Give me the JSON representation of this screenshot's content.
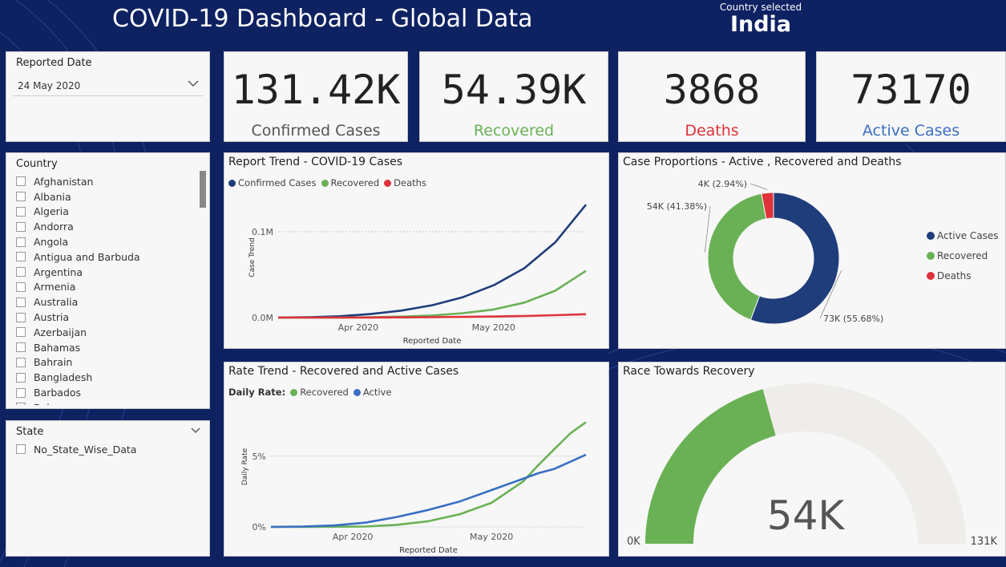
{
  "header": {
    "title": "COVID-19 Dashboard - Global Data",
    "country_label": "Country selected",
    "country_value": "India"
  },
  "reported_date": {
    "title": "Reported Date",
    "value": "24 May 2020"
  },
  "kpis": [
    {
      "value": "131.42K",
      "label": "Confirmed Cases",
      "color": "#555555"
    },
    {
      "value": "54.39K",
      "label": "Recovered",
      "color": "#6ab155"
    },
    {
      "value": "3868",
      "label": "Deaths",
      "color": "#e0323b"
    },
    {
      "value": "73170",
      "label": "Active Cases",
      "color": "#3a6fc4"
    }
  ],
  "country_slicer": {
    "title": "Country",
    "items": [
      "Afghanistan",
      "Albania",
      "Algeria",
      "Andorra",
      "Angola",
      "Antigua and Barbuda",
      "Argentina",
      "Armenia",
      "Australia",
      "Austria",
      "Azerbaijan",
      "Bahamas",
      "Bahrain",
      "Bangladesh",
      "Barbados",
      "Belarus"
    ]
  },
  "state_slicer": {
    "title": "State",
    "items": [
      "No_State_Wise_Data"
    ]
  },
  "report_trend": {
    "title": "Report Trend - COVID-19 Cases"
  },
  "case_proportions": {
    "title": "Case Proportions - Active , Recovered and Deaths"
  },
  "rate_trend": {
    "title": "Rate Trend - Recovered and Active Cases",
    "legend_prefix": "Daily Rate:"
  },
  "race": {
    "title": "Race Towards Recovery"
  },
  "icons": {
    "dropdown": "chevron-down-icon"
  },
  "chart_data": [
    {
      "type": "line",
      "title": "Report Trend - COVID-19 Cases",
      "xlabel": "Reported Date",
      "ylabel": "Case Trend",
      "x_ticks": [
        "Apr 2020",
        "May 2020"
      ],
      "y_ticks": [
        "0.0M",
        "0.1M"
      ],
      "ylim": [
        0,
        0.14
      ],
      "x": [
        0,
        0.1,
        0.2,
        0.3,
        0.4,
        0.5,
        0.6,
        0.7,
        0.8,
        0.9,
        1.0
      ],
      "series": [
        {
          "name": "Confirmed Cases",
          "color": "#1f3d7a",
          "values": [
            0.0001,
            0.0005,
            0.0016,
            0.0041,
            0.0081,
            0.0144,
            0.0237,
            0.0376,
            0.0575,
            0.0875,
            0.1314
          ]
        },
        {
          "name": "Recovered",
          "color": "#6ab155",
          "values": [
            0,
            0,
            0.0001,
            0.0004,
            0.0011,
            0.0024,
            0.0051,
            0.0094,
            0.0175,
            0.0313,
            0.0544
          ]
        },
        {
          "name": "Deaths",
          "color": "#e0323b",
          "values": [
            0,
            0,
            0,
            0.0001,
            0.0003,
            0.0005,
            0.0008,
            0.0012,
            0.0019,
            0.0028,
            0.0039
          ]
        }
      ]
    },
    {
      "type": "pie",
      "title": "Case Proportions - Active , Recovered and Deaths",
      "donut": true,
      "slices": [
        {
          "name": "Active Cases",
          "value": 55.68,
          "label": "73K (55.68%)",
          "color": "#1f3d7a"
        },
        {
          "name": "Recovered",
          "value": 41.38,
          "label": "54K (41.38%)",
          "color": "#6ab155"
        },
        {
          "name": "Deaths",
          "value": 2.94,
          "label": "4K (2.94%)",
          "color": "#e0323b"
        }
      ],
      "legend": "right"
    },
    {
      "type": "line",
      "title": "Rate Trend - Recovered and Active Cases",
      "xlabel": "Reported Date",
      "ylabel": "Daily Rate",
      "x_ticks": [
        "Apr 2020",
        "May 2020"
      ],
      "y_ticks": [
        "0%",
        "5%"
      ],
      "ylim": [
        0,
        0.085
      ],
      "x": [
        0,
        0.1,
        0.2,
        0.3,
        0.4,
        0.5,
        0.6,
        0.7,
        0.8,
        0.85,
        0.9,
        0.95,
        1.0
      ],
      "series": [
        {
          "name": "Recovered",
          "color": "#6ab155",
          "values": [
            0,
            0,
            0.0001,
            0.0003,
            0.0015,
            0.004,
            0.009,
            0.017,
            0.032,
            0.044,
            0.055,
            0.066,
            0.074
          ]
        },
        {
          "name": "Active",
          "color": "#3a6fc4",
          "values": [
            0,
            0.0002,
            0.001,
            0.003,
            0.007,
            0.012,
            0.018,
            0.026,
            0.034,
            0.038,
            0.041,
            0.046,
            0.051
          ]
        }
      ]
    },
    {
      "type": "gauge",
      "title": "Race Towards Recovery",
      "value": 54.39,
      "value_label": "54K",
      "min": 0,
      "min_label": "0K",
      "max": 131.42,
      "max_label": "131K",
      "fill_color": "#6ab155",
      "track_color": "#efedea"
    }
  ]
}
